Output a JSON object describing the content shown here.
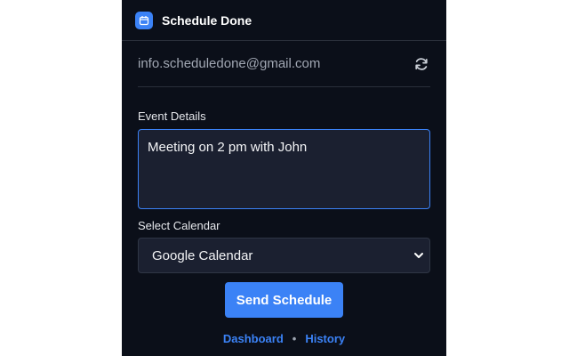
{
  "header": {
    "title": "Schedule Done",
    "logo_icon": "calendar-icon",
    "accent": "#3b82f6"
  },
  "account": {
    "email": "info.scheduledone@gmail.com",
    "refresh_icon": "refresh-icon"
  },
  "event": {
    "label": "Event Details",
    "value": "Meeting on 2 pm with John"
  },
  "calendar": {
    "label": "Select Calendar",
    "selected": "Google Calendar"
  },
  "actions": {
    "send_label": "Send Schedule"
  },
  "footer": {
    "links": [
      "Dashboard",
      "History"
    ],
    "separator": "•"
  }
}
